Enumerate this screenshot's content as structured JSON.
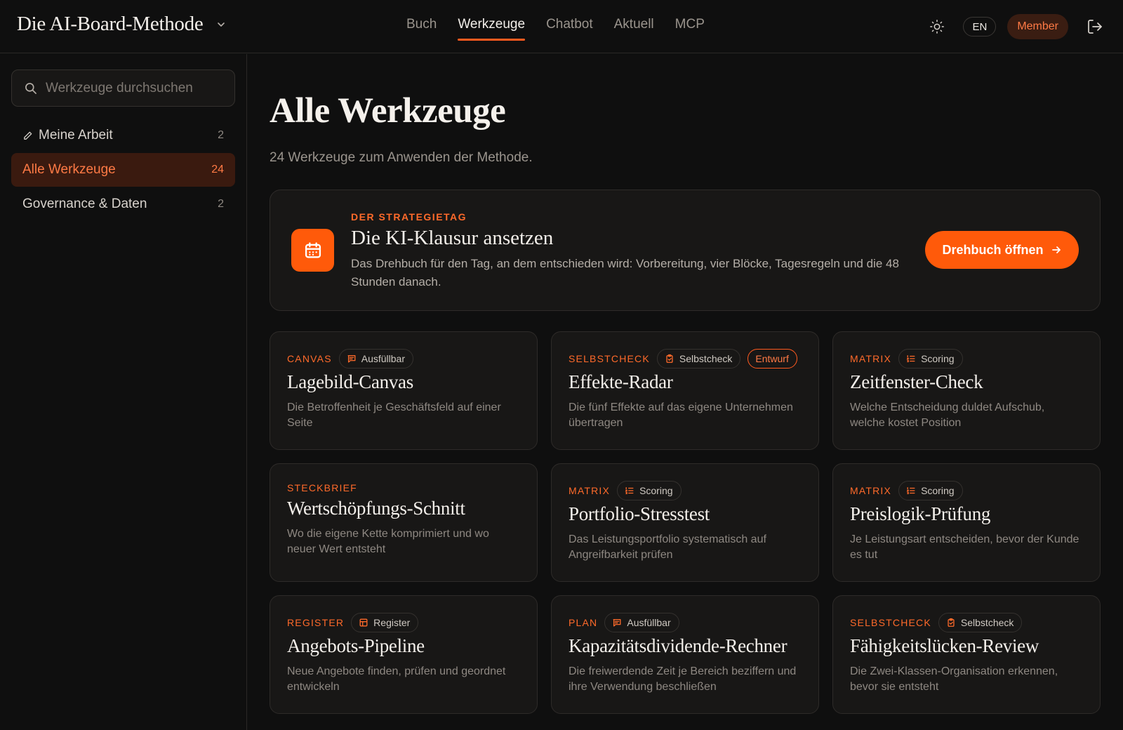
{
  "header": {
    "brand": "Die AI-Board-Methode",
    "nav": [
      {
        "label": "Buch",
        "active": false
      },
      {
        "label": "Werkzeuge",
        "active": true
      },
      {
        "label": "Chatbot",
        "active": false
      },
      {
        "label": "Aktuell",
        "active": false
      },
      {
        "label": "MCP",
        "active": false
      }
    ],
    "lang": "EN",
    "member": "Member"
  },
  "sidebar": {
    "search_placeholder": "Werkzeuge durchsuchen",
    "items": [
      {
        "label": "Meine Arbeit",
        "count": "2",
        "icon": "pencil-icon",
        "active": false
      },
      {
        "label": "Alle Werkzeuge",
        "count": "24",
        "active": true
      },
      {
        "label": "Governance & Daten",
        "count": "2",
        "active": false
      }
    ]
  },
  "main": {
    "title": "Alle Werkzeuge",
    "subtitle": "24 Werkzeuge zum Anwenden der Methode.",
    "feature": {
      "eyebrow": "DER STRATEGIETAG",
      "title": "Die KI-Klausur ansetzen",
      "description": "Das Drehbuch für den Tag, an dem entschieden wird: Vorbereitung, vier Blöcke, Tagesregeln und die 48 Stunden danach.",
      "cta": "Drehbuch öffnen",
      "icon": "calendar-icon"
    },
    "cards": [
      {
        "category": "CANVAS",
        "badge": "Ausfüllbar",
        "badge_icon": "chat-icon",
        "title": "Lagebild-Canvas",
        "description": "Die Betroffenheit je Geschäftsfeld auf einer Seite"
      },
      {
        "category": "SELBSTCHECK",
        "badge": "Selbstcheck",
        "badge_icon": "clipboard-icon",
        "draft": "Entwurf",
        "title": "Effekte-Radar",
        "description": "Die fünf Effekte auf das eigene Unternehmen übertragen"
      },
      {
        "category": "MATRIX",
        "badge": "Scoring",
        "badge_icon": "list-icon",
        "title": "Zeitfenster-Check",
        "description": "Welche Entscheidung duldet Aufschub, welche kostet Position"
      },
      {
        "category": "STECKBRIEF",
        "title": "Wertschöpfungs-Schnitt",
        "description": "Wo die eigene Kette komprimiert und wo neuer Wert entsteht"
      },
      {
        "category": "MATRIX",
        "badge": "Scoring",
        "badge_icon": "list-icon",
        "title": "Portfolio-Stresstest",
        "description": "Das Leistungsportfolio systematisch auf Angreifbarkeit prüfen"
      },
      {
        "category": "MATRIX",
        "badge": "Scoring",
        "badge_icon": "list-icon",
        "title": "Preislogik-Prüfung",
        "description": "Je Leistungsart entscheiden, bevor der Kunde es tut"
      },
      {
        "category": "REGISTER",
        "badge": "Register",
        "badge_icon": "table-icon",
        "title": "Angebots-Pipeline",
        "description": "Neue Angebote finden, prüfen und geordnet entwickeln"
      },
      {
        "category": "PLAN",
        "badge": "Ausfüllbar",
        "badge_icon": "chat-icon",
        "title": "Kapazitätsdividende-Rechner",
        "description": "Die freiwerdende Zeit je Bereich beziffern und ihre Verwendung beschließen"
      },
      {
        "category": "SELBSTCHECK",
        "badge": "Selbstcheck",
        "badge_icon": "clipboard-icon",
        "title": "Fähigkeitslücken-Review",
        "description": "Die Zwei-Klassen-Organisation erkennen, bevor sie entsteht"
      }
    ]
  },
  "colors": {
    "accent": "#ff5a0a",
    "accent_text": "#ff6a2a",
    "background": "#0f0f0f",
    "card": "#181716"
  }
}
